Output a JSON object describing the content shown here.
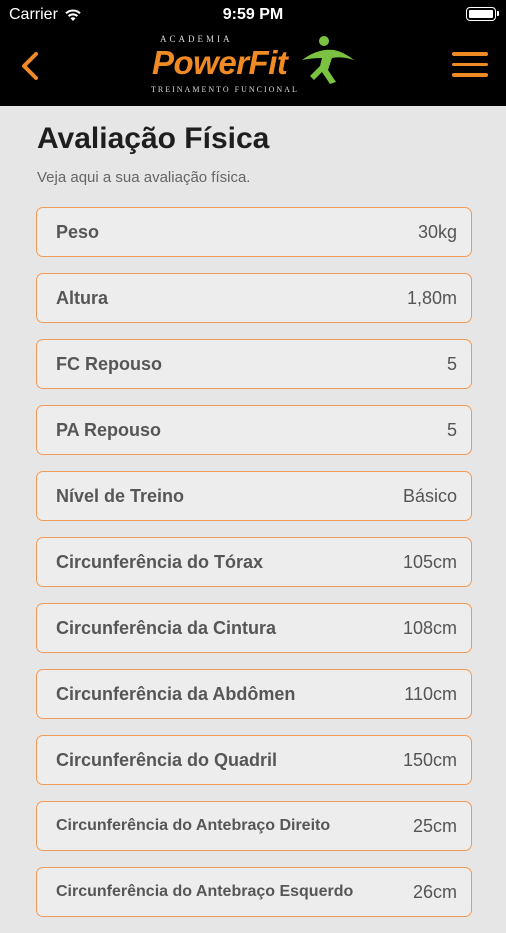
{
  "status_bar": {
    "carrier": "Carrier",
    "time": "9:59 PM"
  },
  "header": {
    "logo": {
      "top": "ACADEMIA",
      "brand": "PowerFit",
      "sub": "TREINAMENTO FUNCIONAL"
    },
    "accent_color": "#f08a24",
    "back_icon": "chevron-left-icon",
    "menu_icon": "hamburger-menu-icon"
  },
  "page": {
    "title": "Avaliação Física",
    "subtitle": "Veja aqui a sua avaliação física."
  },
  "measurements": [
    {
      "label": "Peso",
      "value": "30kg"
    },
    {
      "label": "Altura",
      "value": "1,80m"
    },
    {
      "label": "FC Repouso",
      "value": "5"
    },
    {
      "label": "PA Repouso",
      "value": "5"
    },
    {
      "label": "Nível de Treino",
      "value": "Básico"
    },
    {
      "label": "Circunferência do Tórax",
      "value": "105cm"
    },
    {
      "label": "Circunferência da Cintura",
      "value": "108cm"
    },
    {
      "label": "Circunferência da Abdômen",
      "value": "110cm"
    },
    {
      "label": "Circunferência do Quadril",
      "value": "150cm"
    },
    {
      "label": "Circunferência do Antebraço Direito",
      "value": "25cm"
    },
    {
      "label": "Circunferência do Antebraço Esquerdo",
      "value": "26cm"
    }
  ]
}
